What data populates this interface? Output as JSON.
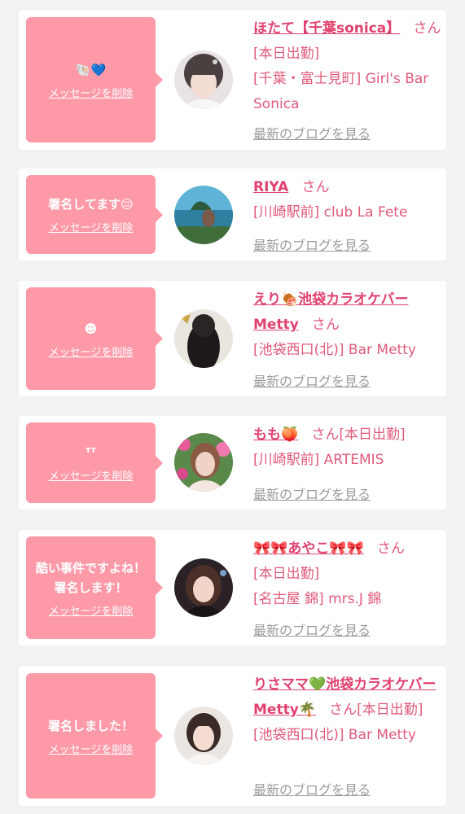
{
  "delete_label": "メッセージを削除",
  "blog_label": "最新のブログを見る",
  "san": "さん",
  "colors": {
    "accent": "#fe9aa8",
    "name": "#e0426e",
    "bg": "#f2f2f2"
  },
  "items": [
    {
      "message": "🐚💙",
      "name": "ほたて【千葉sonica】",
      "status": "[本日出勤]",
      "shop": "[千葉・富士見町] Girl's Bar Sonica"
    },
    {
      "message": "署名してます😔",
      "name": "RIYA",
      "status": "",
      "shop": "[川崎駅前] club La Fete"
    },
    {
      "message": "☻",
      "name": "えり🍖池袋カラオケバーMetty",
      "status": "",
      "shop": "[池袋西口(北)] Bar Metty"
    },
    {
      "message": "ᵀᵀ",
      "name": "もも🍑",
      "status": "[本日出勤]",
      "shop": "[川崎駅前] ARTEMIS"
    },
    {
      "message": "酷い事件ですよね！署名します！",
      "name": "🎀🎀あやこ🎀🎀",
      "status": "[本日出勤]",
      "shop": "[名古屋 錦] mrs.J 錦"
    },
    {
      "message": "署名しました！",
      "name": "りさママ💚池袋カラオケバーMetty🌴",
      "status": "[本日出勤]",
      "shop": "[池袋西口(北)] Bar Metty"
    }
  ]
}
